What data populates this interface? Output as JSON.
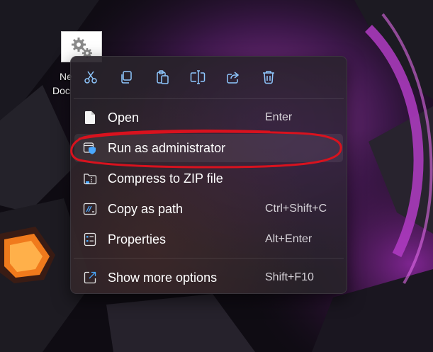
{
  "desktop_icon": {
    "line1": "Ne",
    "line2": "Doc"
  },
  "toolbar": {
    "buttons": [
      "cut-icon",
      "copy-icon",
      "paste-icon",
      "rename-icon",
      "share-icon",
      "delete-icon"
    ]
  },
  "menu": {
    "items": [
      {
        "label": "Open",
        "shortcut": "Enter",
        "icon": "document-icon"
      },
      {
        "label": "Run as administrator",
        "shortcut": "",
        "icon": "shield-icon"
      },
      {
        "label": "Compress to ZIP file",
        "shortcut": "",
        "icon": "zip-folder-icon"
      },
      {
        "label": "Copy as path",
        "shortcut": "Ctrl+Shift+C",
        "icon": "copy-path-icon"
      },
      {
        "label": "Properties",
        "shortcut": "Alt+Enter",
        "icon": "properties-icon"
      },
      {
        "label": "Show more options",
        "shortcut": "Shift+F10",
        "icon": "expand-icon"
      }
    ]
  },
  "colors": {
    "accent": "#4aa8ff",
    "annotation": "#d8121e",
    "menu_bg": "#28222a"
  }
}
